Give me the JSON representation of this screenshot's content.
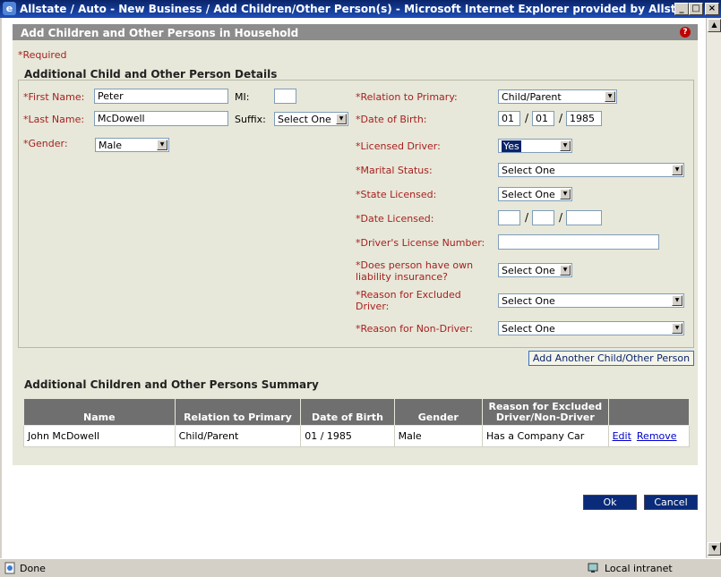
{
  "window": {
    "title": "Allstate / Auto - New Business / Add Children/Other Person(s) - Microsoft Internet Explorer provided by Allstate",
    "ie_icon": "e",
    "buttons": {
      "minimize": "_",
      "maximize": "□",
      "close": "×"
    }
  },
  "header": {
    "title": "Add Children and Other Persons in Household",
    "help_glyph": "?"
  },
  "required_note": "*Required",
  "details": {
    "section_title": "Additional Child and Other Person Details",
    "first_name": {
      "label": "*First Name:",
      "value": "Peter"
    },
    "mi": {
      "label": "MI:",
      "value": ""
    },
    "last_name": {
      "label": "*Last Name:",
      "value": "McDowell"
    },
    "suffix": {
      "label": "Suffix:",
      "value": "Select One"
    },
    "gender": {
      "label": "*Gender:",
      "value": "Male"
    },
    "relation": {
      "label": "*Relation to Primary:",
      "value": "Child/Parent"
    },
    "dob": {
      "label": "*Date of Birth:",
      "month": "01",
      "day": "01",
      "year": "1985"
    },
    "licensed_driver": {
      "label": "*Licensed Driver:",
      "value": "Yes"
    },
    "marital_status": {
      "label": "*Marital Status:",
      "value": "Select One"
    },
    "state_licensed": {
      "label": "*State Licensed:",
      "value": "Select One"
    },
    "date_licensed": {
      "label": "*Date Licensed:",
      "month": "",
      "day": "",
      "year": ""
    },
    "license_number": {
      "label": "*Driver's License Number:",
      "value": ""
    },
    "own_liability": {
      "label_line1": "*Does person have own",
      "label_line2": "liability insurance?",
      "value": "Select One"
    },
    "excluded_reason": {
      "label_line1": "*Reason for Excluded",
      "label_line2": "Driver:",
      "value": "Select One"
    },
    "non_driver_reason": {
      "label": "*Reason for Non-Driver:",
      "value": "Select One"
    },
    "date_separator": "/",
    "add_button": "Add Another Child/Other Person"
  },
  "summary": {
    "section_title": "Additional Children and Other Persons Summary",
    "columns": [
      "Name",
      "Relation to Primary",
      "Date of Birth",
      "Gender",
      "Reason for Excluded Driver/Non-Driver",
      ""
    ],
    "rows": [
      {
        "name": "John McDowell",
        "relation": "Child/Parent",
        "dob": "01 / 1985",
        "gender": "Male",
        "reason": "Has a Company Car",
        "edit": "Edit",
        "remove": "Remove"
      }
    ]
  },
  "actions": {
    "ok": "Ok",
    "cancel": "Cancel"
  },
  "statusbar": {
    "status": "Done",
    "zone": "Local intranet"
  },
  "scroll": {
    "up": "▲",
    "down": "▼"
  },
  "colors": {
    "label_red": "#a82020",
    "panel": "#e7e8d9",
    "header_gray": "#8c8c8c",
    "button_blue": "#0a2b7a",
    "link_blue": "#0000cc"
  }
}
